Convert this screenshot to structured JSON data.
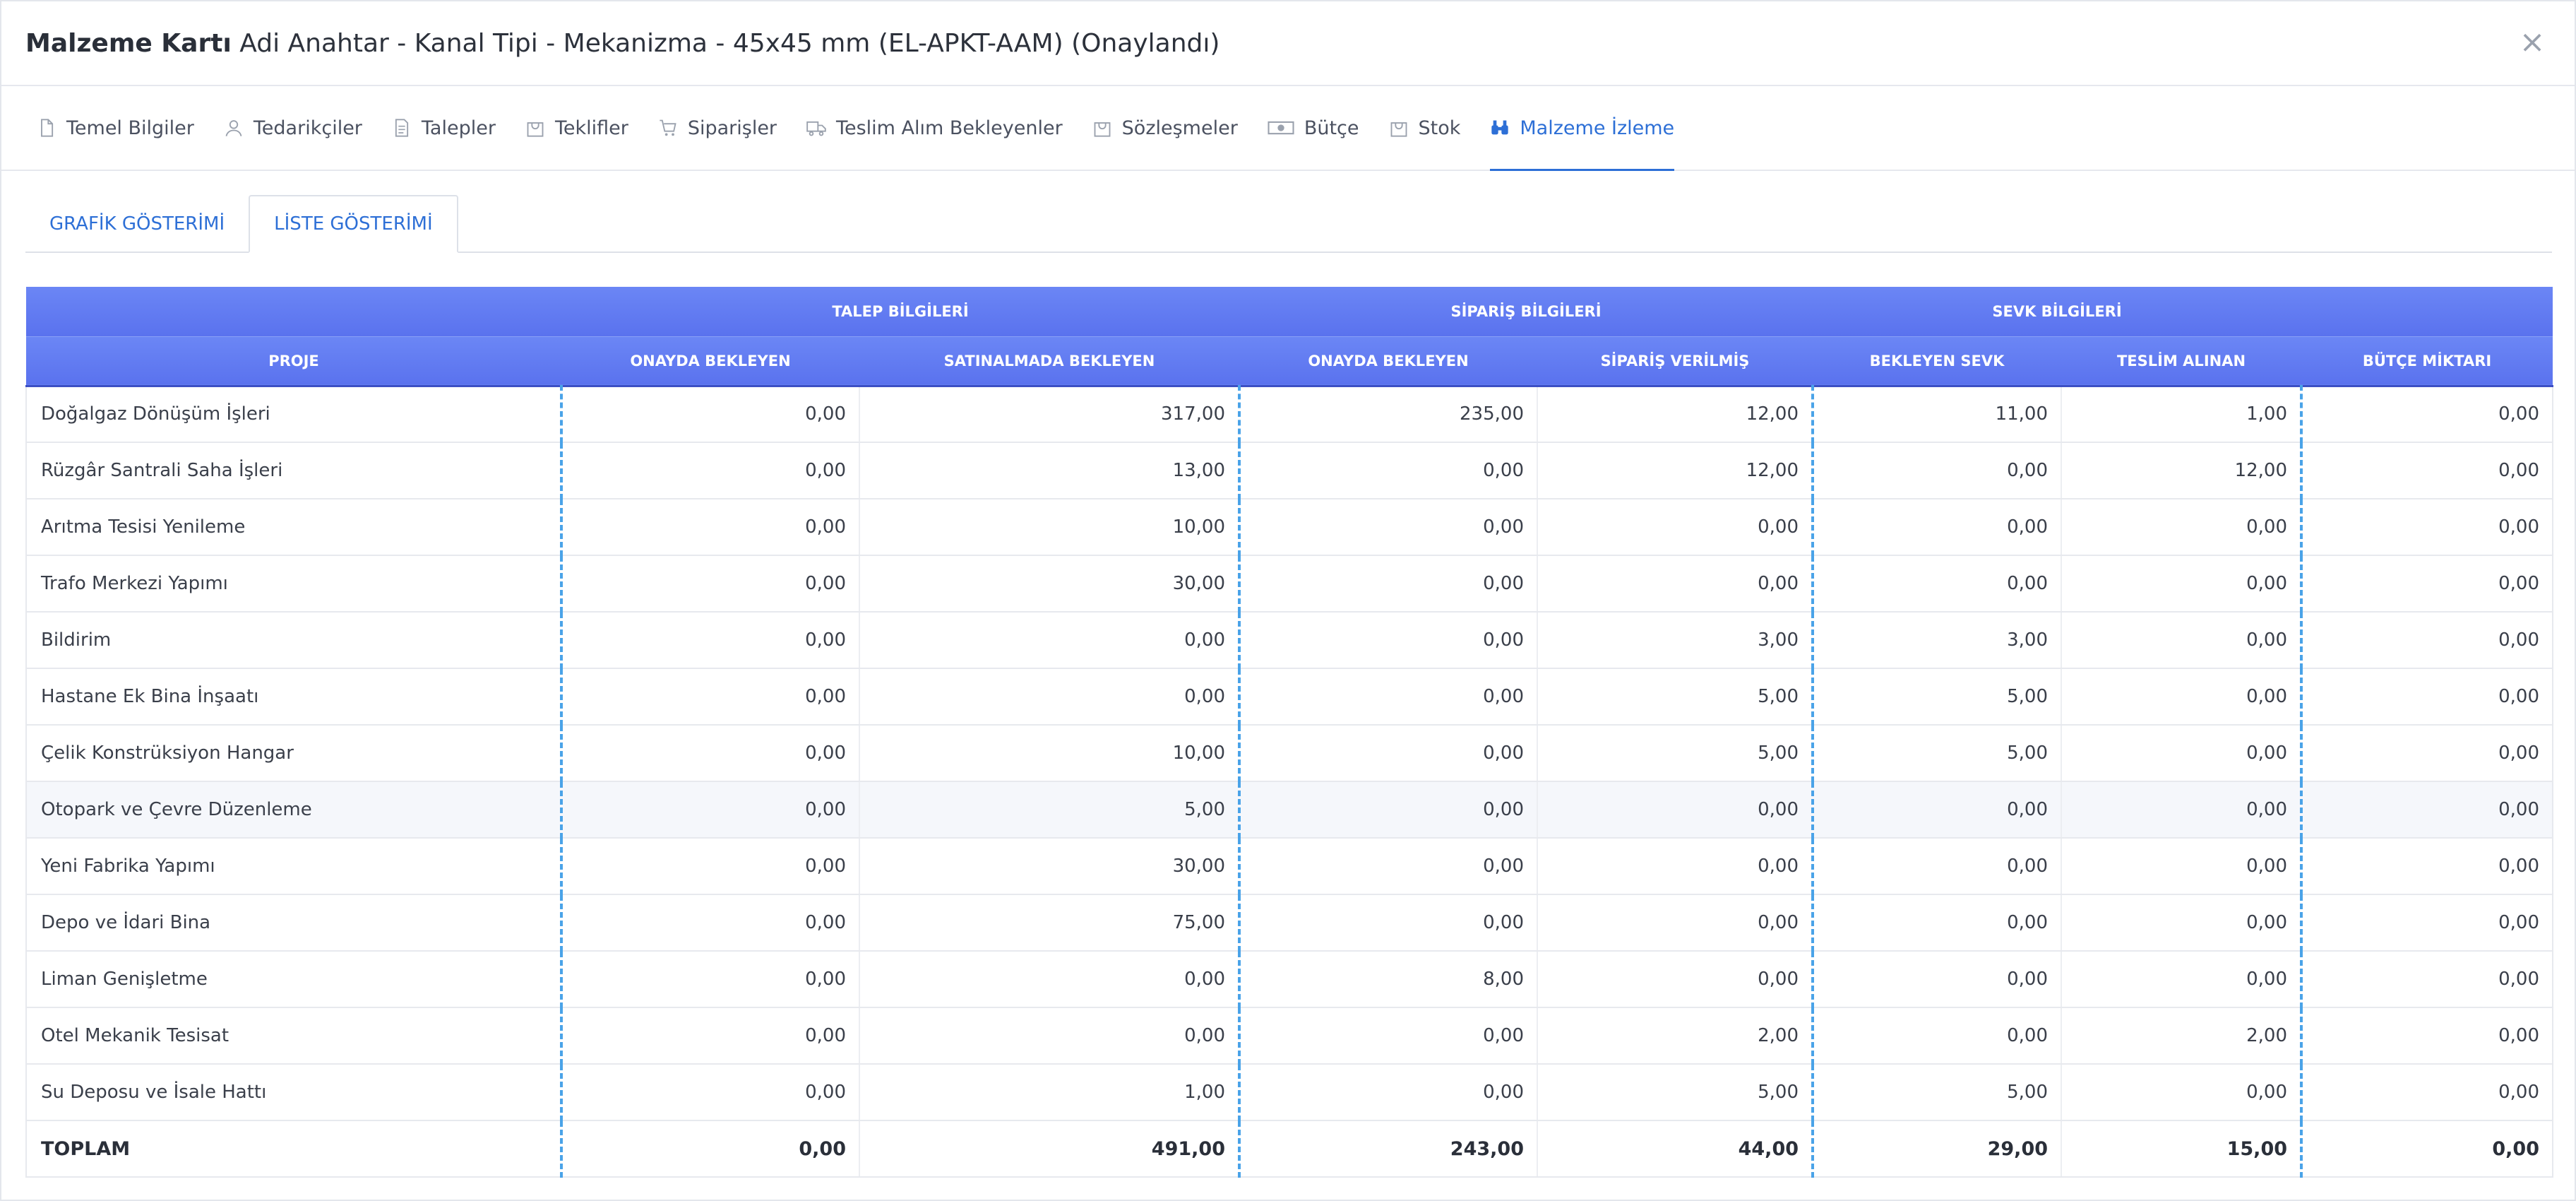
{
  "header": {
    "title_strong": "Malzeme Kartı",
    "title_rest": " Adi Anahtar - Kanal Tipi - Mekanizma - 45x45 mm (EL-APKT-AAM) (Onaylandı)",
    "close": "×"
  },
  "tabs": [
    {
      "label": "Temel Bilgiler",
      "icon": "file-icon"
    },
    {
      "label": "Tedarikçiler",
      "icon": "user-icon"
    },
    {
      "label": "Talepler",
      "icon": "document-icon"
    },
    {
      "label": "Teklifler",
      "icon": "bag-icon"
    },
    {
      "label": "Siparişler",
      "icon": "cart-icon"
    },
    {
      "label": "Teslim Alım Bekleyenler",
      "icon": "truck-icon"
    },
    {
      "label": "Sözleşmeler",
      "icon": "bag-icon"
    },
    {
      "label": "Bütçe",
      "icon": "money-icon"
    },
    {
      "label": "Stok",
      "icon": "bag-icon"
    },
    {
      "label": "Malzeme İzleme",
      "icon": "binoculars-icon",
      "active": true
    }
  ],
  "subtabs": [
    {
      "label": "GRAFİK GÖSTERİMİ"
    },
    {
      "label": "LİSTE GÖSTERİMİ",
      "active": true
    }
  ],
  "table": {
    "groups": {
      "talep": "TALEP BİLGİLERİ",
      "siparis": "SİPARİŞ BİLGİLERİ",
      "sevk": "SEVK BİLGİLERİ"
    },
    "columns": [
      "PROJE",
      "ONAYDA BEKLEYEN",
      "SATINALMADA BEKLEYEN",
      "ONAYDA BEKLEYEN",
      "SİPARİŞ VERİLMİŞ",
      "BEKLEYEN SEVK",
      "TESLİM ALINAN",
      "BÜTÇE MİKTARI"
    ],
    "rows": [
      [
        "Doğalgaz Dönüşüm İşleri",
        "0,00",
        "317,00",
        "235,00",
        "12,00",
        "11,00",
        "1,00",
        "0,00"
      ],
      [
        "Rüzgâr Santrali Saha İşleri",
        "0,00",
        "13,00",
        "0,00",
        "12,00",
        "0,00",
        "12,00",
        "0,00"
      ],
      [
        "Arıtma Tesisi Yenileme",
        "0,00",
        "10,00",
        "0,00",
        "0,00",
        "0,00",
        "0,00",
        "0,00"
      ],
      [
        "Trafo Merkezi Yapımı",
        "0,00",
        "30,00",
        "0,00",
        "0,00",
        "0,00",
        "0,00",
        "0,00"
      ],
      [
        "Bildirim",
        "0,00",
        "0,00",
        "0,00",
        "3,00",
        "3,00",
        "0,00",
        "0,00"
      ],
      [
        "Hastane Ek Bina İnşaatı",
        "0,00",
        "0,00",
        "0,00",
        "5,00",
        "5,00",
        "0,00",
        "0,00"
      ],
      [
        "Çelik Konstrüksiyon Hangar",
        "0,00",
        "10,00",
        "0,00",
        "5,00",
        "5,00",
        "0,00",
        "0,00"
      ],
      [
        "Otopark ve Çevre Düzenleme",
        "0,00",
        "5,00",
        "0,00",
        "0,00",
        "0,00",
        "0,00",
        "0,00"
      ],
      [
        "Yeni Fabrika Yapımı",
        "0,00",
        "30,00",
        "0,00",
        "0,00",
        "0,00",
        "0,00",
        "0,00"
      ],
      [
        "Depo ve İdari Bina",
        "0,00",
        "75,00",
        "0,00",
        "0,00",
        "0,00",
        "0,00",
        "0,00"
      ],
      [
        "Liman Genişletme",
        "0,00",
        "0,00",
        "8,00",
        "0,00",
        "0,00",
        "0,00",
        "0,00"
      ],
      [
        "Otel Mekanik Tesisat",
        "0,00",
        "0,00",
        "0,00",
        "2,00",
        "0,00",
        "2,00",
        "0,00"
      ],
      [
        "Su Deposu ve İsale Hattı",
        "0,00",
        "1,00",
        "0,00",
        "5,00",
        "5,00",
        "0,00",
        "0,00"
      ]
    ],
    "total": [
      "TOPLAM",
      "0,00",
      "491,00",
      "243,00",
      "44,00",
      "29,00",
      "15,00",
      "0,00"
    ]
  }
}
